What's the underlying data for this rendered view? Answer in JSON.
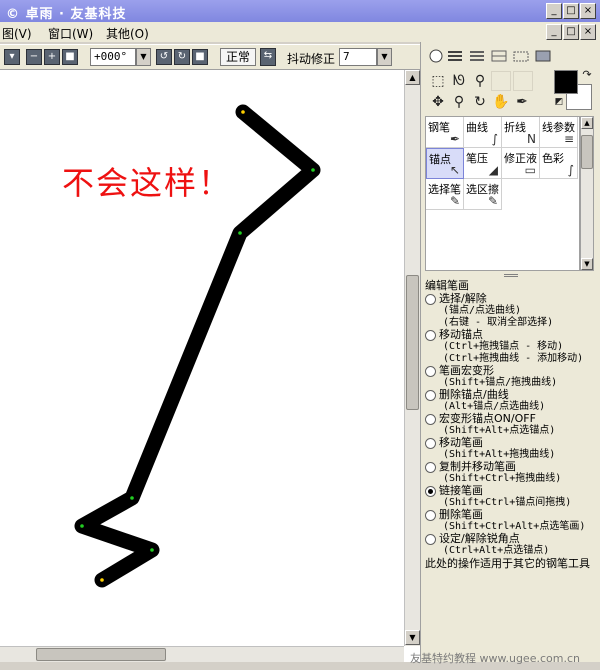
{
  "window": {
    "title": "© 卓雨 · 友基科技",
    "btn_min": "_",
    "btn_max": "□",
    "btn_close": "×"
  },
  "menu": {
    "items": [
      "图(V)",
      "窗口(W)",
      "其他(O)"
    ]
  },
  "toolbar": {
    "zoom_out": "−",
    "zoom_in": "+",
    "rotation_value": "+000°",
    "blend_mode": "正常",
    "stabilizer_label": "抖动修正",
    "stabilizer_value": "7"
  },
  "canvas": {
    "annotation": "不会这样！"
  },
  "tools": {
    "grid": [
      {
        "label": "钢笔",
        "icon": "✒",
        "selected": false
      },
      {
        "label": "曲线",
        "icon": "∫",
        "selected": false
      },
      {
        "label": "折线",
        "icon": "N",
        "selected": false
      },
      {
        "label": "线参数",
        "icon": "≡",
        "selected": false
      },
      {
        "label": "锚点",
        "icon": "↖",
        "selected": true
      },
      {
        "label": "笔压",
        "icon": "◢",
        "selected": false
      },
      {
        "label": "修正液",
        "icon": "▭",
        "selected": false
      },
      {
        "label": "色彩",
        "icon": "∫",
        "selected": false
      },
      {
        "label": "选择笔",
        "icon": "✎",
        "selected": false
      },
      {
        "label": "选区擦",
        "icon": "✎",
        "selected": false
      }
    ]
  },
  "info": {
    "header": "编辑笔画",
    "options": [
      {
        "label": "选择/解除",
        "selected": false,
        "desc": [
          "(锚点/点选曲线)",
          "(右键 - 取消全部选择)"
        ]
      },
      {
        "label": "移动锚点",
        "selected": false,
        "desc": [
          "(Ctrl+拖拽锚点 - 移动)",
          "(Ctrl+拖拽曲线 - 添加移动)"
        ]
      },
      {
        "label": "笔画宏变形",
        "selected": false,
        "desc": [
          "(Shift+锚点/拖拽曲线)"
        ]
      },
      {
        "label": "删除锚点/曲线",
        "selected": false,
        "desc": [
          "(Alt+锚点/点选曲线)"
        ]
      },
      {
        "label": "宏变形锚点ON/OFF",
        "selected": false,
        "desc": [
          "(Shift+Alt+点选锚点)"
        ]
      },
      {
        "label": "移动笔画",
        "selected": false,
        "desc": [
          "(Shift+Alt+拖拽曲线)"
        ]
      },
      {
        "label": "复制并移动笔画",
        "selected": false,
        "desc": [
          "(Shift+Ctrl+拖拽曲线)"
        ]
      },
      {
        "label": "链接笔画",
        "selected": true,
        "desc": [
          "(Shift+Ctrl+锚点间拖拽)"
        ]
      },
      {
        "label": "删除笔画",
        "selected": false,
        "desc": [
          "(Shift+Ctrl+Alt+点选笔画)"
        ]
      },
      {
        "label": "设定/解除锐角点",
        "selected": false,
        "desc": [
          "(Ctrl+Alt+点选锚点)"
        ]
      }
    ],
    "footnote": "此处的操作适用于其它的钢笔工具"
  },
  "watermark": "友基特约教程  www.ugee.com.cn"
}
